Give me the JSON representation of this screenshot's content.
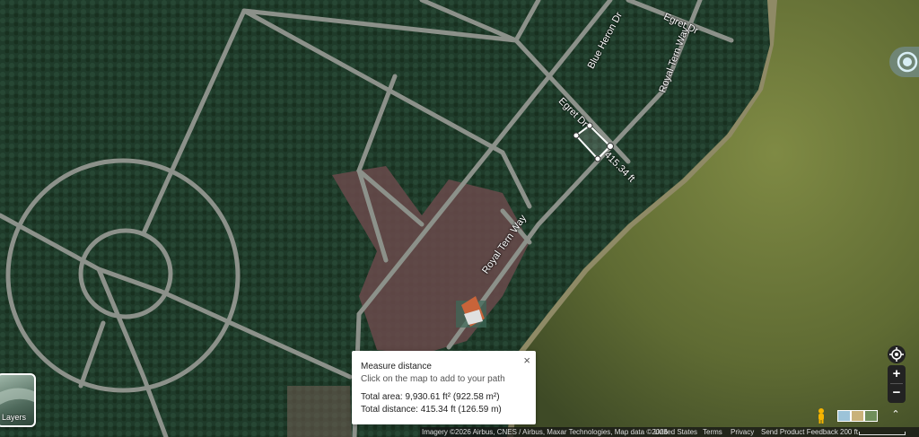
{
  "roads": [
    {
      "id": "egret-dr-top",
      "label": "Egret Dr"
    },
    {
      "id": "blue-heron-dr",
      "label": "Blue Heron Dr"
    },
    {
      "id": "royal-tern-way-top",
      "label": "Royal Tern Way"
    },
    {
      "id": "egret-dr-mid",
      "label": "Egret Dr"
    },
    {
      "id": "royal-tern-way-mid",
      "label": "Royal Tern Way"
    }
  ],
  "measure_label": "415.34 ft",
  "measure_panel": {
    "title": "Measure distance",
    "hint": "Click on the map to add to your path",
    "area": "Total area: 9,930.61 ft² (922.58 m²)",
    "distance": "Total distance: 415.34 ft (126.59 m)",
    "close": "×"
  },
  "layers": {
    "label": "Layers"
  },
  "zoom": {
    "in": "+",
    "out": "−"
  },
  "footer": {
    "attribution": "Imagery ©2026 Airbus, CNES / Airbus, Maxar Technologies, Map data ©2026",
    "country": "United States",
    "terms": "Terms",
    "privacy": "Privacy",
    "feedback": "Send Product Feedback",
    "scale": "200 ft"
  },
  "colors": {
    "forest": "#1e3a28",
    "water": "#6f7a3c",
    "road": "#8a8f88",
    "clearing": "#6e4a4a",
    "roof": "#c8643a"
  }
}
